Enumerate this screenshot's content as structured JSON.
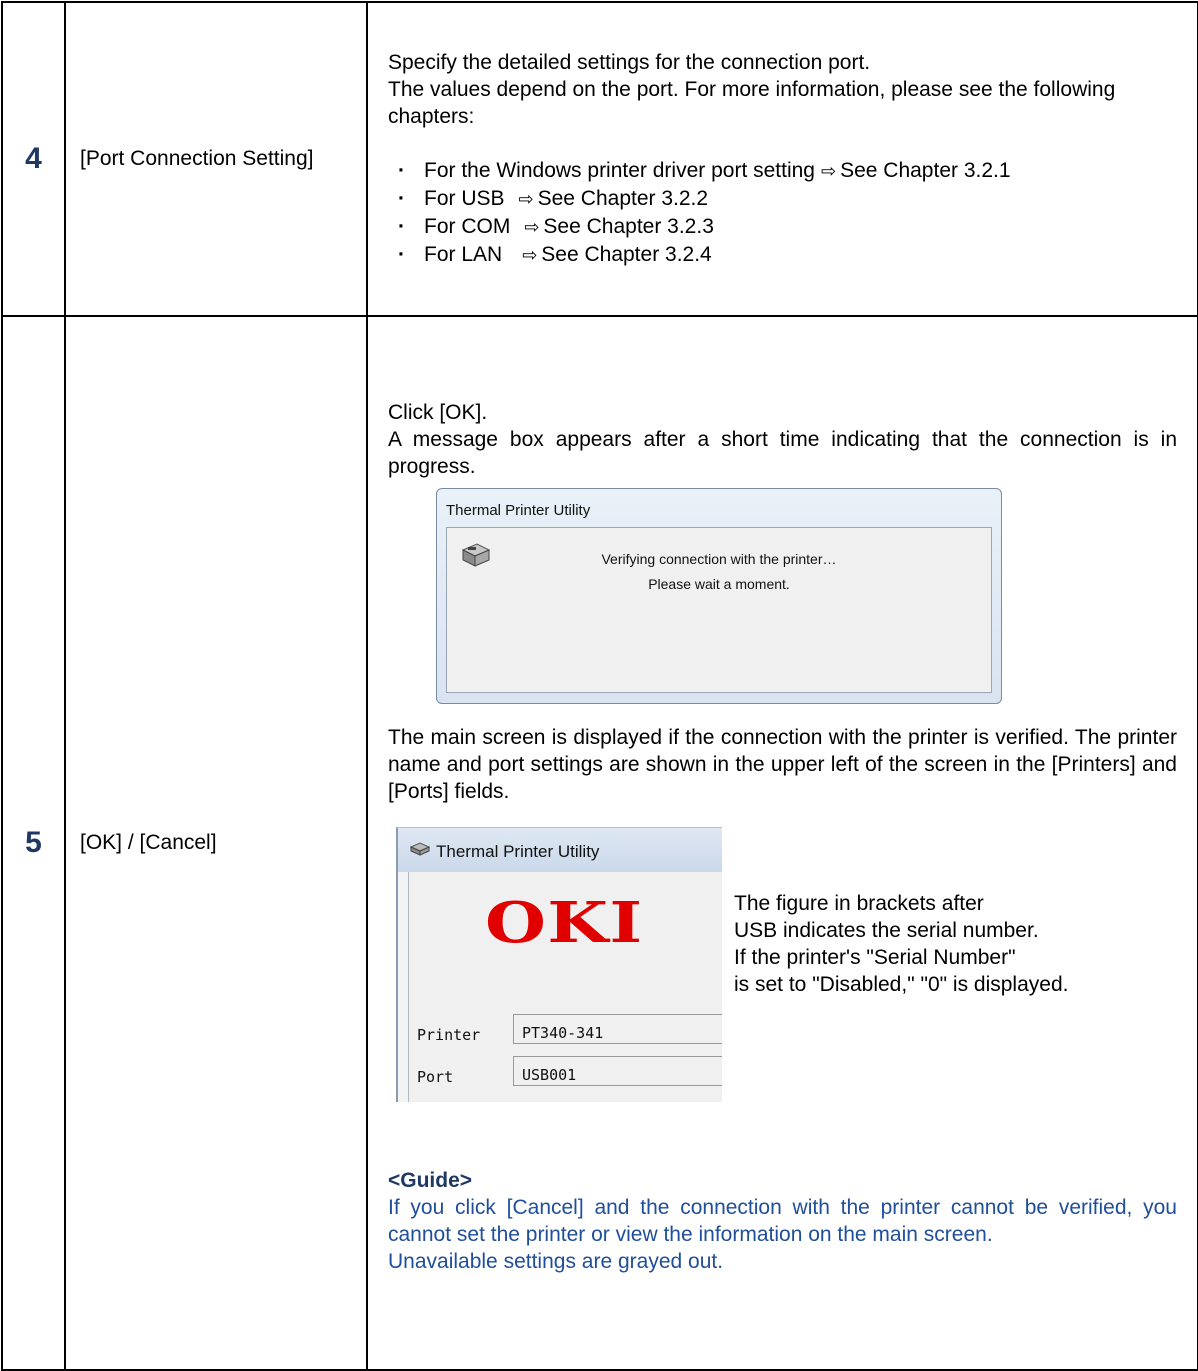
{
  "rows": [
    {
      "num": "4",
      "item": "[Port Connection Setting]",
      "paragraphs": [
        "Specify the detailed settings for the connection port.",
        "The values depend on the port. For more information, please see the following chapters:"
      ],
      "links": [
        {
          "label": "For the Windows printer driver port setting",
          "target": "See Chapter 3.2.1"
        },
        {
          "label": "For USB",
          "target": "See Chapter 3.2.2"
        },
        {
          "label": "For COM",
          "target": "See Chapter 3.2.3"
        },
        {
          "label": "For LAN",
          "target": "See Chapter 3.2.4"
        }
      ]
    },
    {
      "num": "5",
      "item": "[OK] / [Cancel]",
      "intro": [
        "Click [OK].",
        "A message box appears after a short time indicating that the connection is in progress."
      ],
      "dialog": {
        "title": "Thermal Printer Utility",
        "line1": "Verifying connection with the printer…",
        "line2": "Please wait a moment."
      },
      "main_text": "The main screen is displayed if the connection with the printer is verified. The printer name and port settings are shown in the upper left of the screen in the [Printers] and [Ports] fields.",
      "main_screen": {
        "title": "Thermal Printer Utility",
        "logo": "OKI",
        "printer_label": "Printer",
        "printer_value": "PT340-341",
        "port_label": "Port",
        "port_value": "USB001"
      },
      "note_lines": [
        "The figure in brackets after",
        "USB indicates the serial number.",
        "If the printer's \"Serial Number\"",
        "is set to \"Disabled,\" \"0\" is displayed."
      ],
      "guide_title": "<Guide>",
      "guide_lines": [
        "If you click [Cancel] and the connection with the printer cannot be verified, you cannot set the printer or view the information on the main screen.",
        "Unavailable settings are grayed out."
      ]
    }
  ],
  "arrow_glyph": "⇨"
}
